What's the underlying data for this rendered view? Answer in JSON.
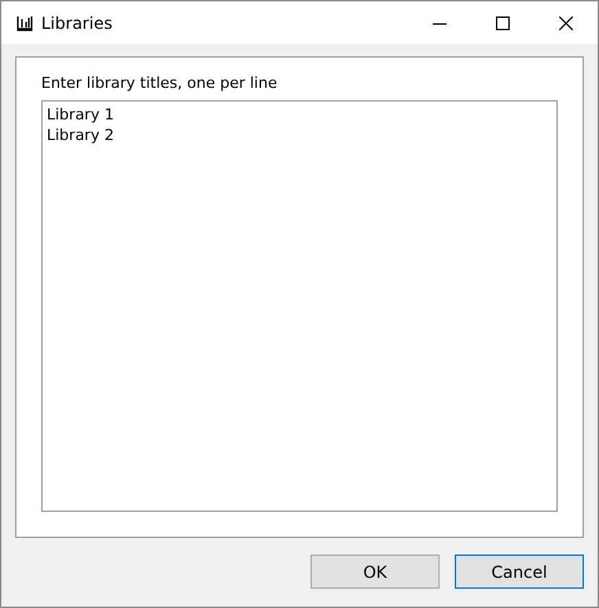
{
  "window": {
    "title": "Libraries"
  },
  "prompt": "Enter library titles, one per line",
  "titles_field": {
    "lines": [
      "Library 1",
      "Library 2"
    ]
  },
  "buttons": [
    {
      "label": "OK",
      "focused": false
    },
    {
      "label": "Cancel",
      "focused": true
    }
  ]
}
